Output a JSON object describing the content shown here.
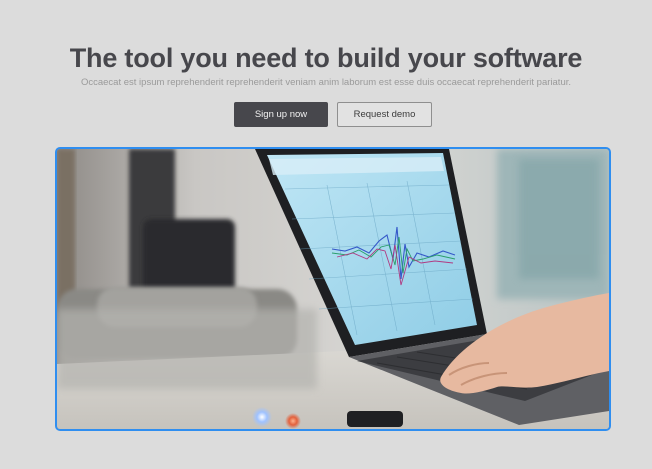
{
  "hero": {
    "headline": "The tool you need to build your software",
    "subheadline": "Occaecat est ipsum reprehenderit reprehenderit veniam anim laborum est esse duis occaecat reprehenderit pariatur.",
    "primary_cta_label": "Sign up now",
    "secondary_cta_label": "Request demo"
  },
  "theme": {
    "background": "#dcdcdc",
    "headline_color": "#47474c",
    "primary_button_color": "#47474c",
    "image_border_color": "#2f8ef0"
  }
}
